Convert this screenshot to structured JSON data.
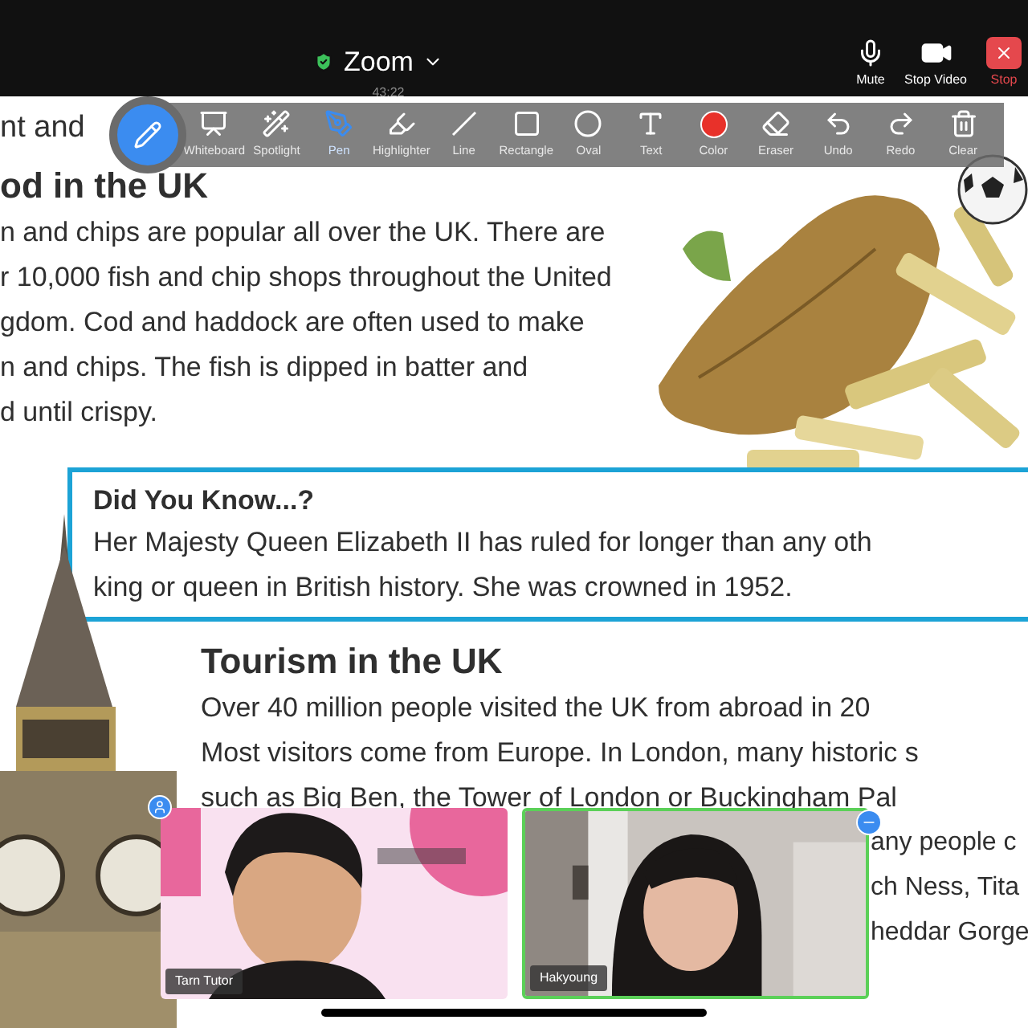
{
  "top_bar": {
    "title": "Zoom",
    "timer": "43:22",
    "buttons": [
      {
        "label": "Mute",
        "kind": "mic"
      },
      {
        "label": "Stop Video",
        "kind": "camera"
      },
      {
        "label": "Stop",
        "kind": "stop"
      }
    ]
  },
  "annotation_toolbar": {
    "tools": [
      {
        "label": "Whiteboard",
        "kind": "whiteboard",
        "selected": false
      },
      {
        "label": "Spotlight",
        "kind": "spotlight",
        "selected": false
      },
      {
        "label": "Pen",
        "kind": "pen",
        "selected": true
      },
      {
        "label": "Highlighter",
        "kind": "highlighter",
        "selected": false
      },
      {
        "label": "Line",
        "kind": "line",
        "selected": false
      },
      {
        "label": "Rectangle",
        "kind": "rectangle",
        "selected": false
      },
      {
        "label": "Oval",
        "kind": "oval",
        "selected": false
      },
      {
        "label": "Text",
        "kind": "text",
        "selected": false
      },
      {
        "label": "Color",
        "kind": "color",
        "selected": false,
        "color": "#e8312a"
      },
      {
        "label": "Eraser",
        "kind": "eraser",
        "selected": false
      },
      {
        "label": "Undo",
        "kind": "undo",
        "selected": false
      },
      {
        "label": "Redo",
        "kind": "redo",
        "selected": false
      },
      {
        "label": "Clear",
        "kind": "clear",
        "selected": false
      }
    ]
  },
  "document": {
    "intro_line": "nt and",
    "food": {
      "heading": "od in the UK",
      "lines": [
        "n and chips are popular all over the UK. There are",
        "r 10,000 fish and chip shops throughout the United",
        "gdom. Cod and haddock are often used to make",
        "n and chips. The fish is dipped in batter and",
        "d until crispy."
      ]
    },
    "did_you_know": {
      "heading": "Did You Know...?",
      "lines": [
        "Her Majesty Queen Elizabeth II has ruled for longer than any oth",
        "king or queen in British history. She was crowned in 1952."
      ]
    },
    "tourism": {
      "heading": "Tourism in the UK",
      "lines": [
        "Over 40 million people visited the UK from abroad in 20",
        "Most visitors come from Europe. In London, many historic s",
        "such as Big Ben, the Tower of London or Buckingham Pal"
      ],
      "partial_lines": [
        "any people c",
        "ch Ness, Tita",
        "heddar Gorge"
      ]
    }
  },
  "video_tiles": [
    {
      "name": "Tarn Tutor",
      "active_speaker": false
    },
    {
      "name": "Hakyoung",
      "active_speaker": true
    }
  ]
}
